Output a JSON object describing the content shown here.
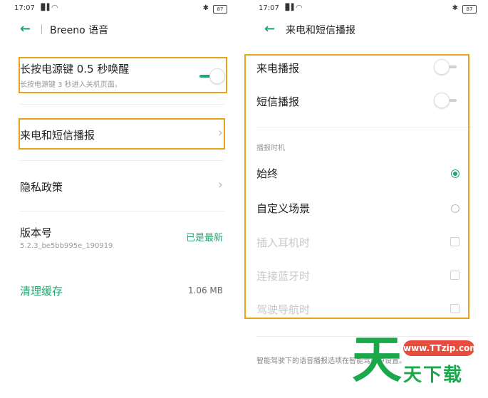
{
  "screen1": {
    "status": {
      "time": "17:07",
      "signal": "▐▌▌",
      "wifi": "◠",
      "bluetooth": "✱",
      "battery": "87"
    },
    "header": {
      "back_icon": "←",
      "title": "Breeno 语音"
    },
    "items": {
      "power_wake": {
        "label": "长按电源键 0.5 秒唤醒",
        "sub": "长按电源键 3 秒进入关机页面。",
        "on": true
      },
      "call_sms": {
        "label": "来电和短信播报",
        "chevron": "›"
      },
      "privacy": {
        "label": "隐私政策",
        "chevron": "›"
      },
      "version": {
        "label": "版本号",
        "sub": "5.2.3_be5bb995e_190919",
        "value": "已是最新"
      },
      "cache": {
        "label": "清理缓存",
        "value": "1.06 MB"
      }
    }
  },
  "screen2": {
    "status": {
      "time": "17:07",
      "signal": "▐▌▌",
      "wifi": "◠",
      "bluetooth": "✱",
      "battery": "87"
    },
    "header": {
      "back_icon": "←",
      "title": "来电和短信播报"
    },
    "items": {
      "call": {
        "label": "来电播报",
        "on": false
      },
      "sms": {
        "label": "短信播报",
        "on": false
      },
      "section": "播报时机",
      "always": {
        "label": "始终",
        "selected": true
      },
      "custom": {
        "label": "自定义场景",
        "selected": false
      },
      "headphones": {
        "label": "插入耳机时"
      },
      "bluetooth": {
        "label": "连接蓝牙时"
      },
      "navigation": {
        "label": "驾驶导航时"
      },
      "footer": "智能驾驶下的语音播报选项在智能驾驶中设置。"
    }
  },
  "watermark": {
    "big": "天",
    "pill": "www.TTzip.com",
    "small": "天下载"
  },
  "colors": {
    "accent": "#22a66e",
    "highlight": "#e8a317",
    "watermark_green": "#1aa84b",
    "watermark_red": "#e84c3d"
  }
}
